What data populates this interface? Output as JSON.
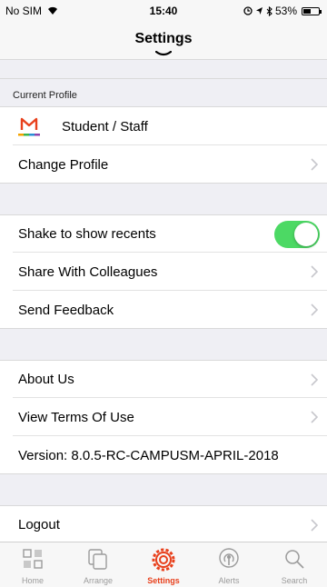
{
  "status_bar": {
    "carrier": "No SIM",
    "time": "15:40",
    "battery_percent": "53%",
    "battery_level": 0.53
  },
  "navbar": {
    "title": "Settings"
  },
  "current_profile": {
    "header": "Current Profile",
    "profile_name": "Student / Staff",
    "change_profile_label": "Change Profile"
  },
  "preferences": {
    "shake_label": "Shake to show recents",
    "shake_enabled": true,
    "share_label": "Share With Colleagues",
    "feedback_label": "Send Feedback"
  },
  "info": {
    "about_label": "About Us",
    "terms_label": "View Terms Of Use",
    "version_label": "Version: 8.0.5-RC-CAMPUSM-APRIL-2018"
  },
  "account": {
    "logout_label": "Logout"
  },
  "tabbar": {
    "tabs": [
      {
        "label": "Home",
        "icon": "home-grid-icon"
      },
      {
        "label": "Arrange",
        "icon": "arrange-icon"
      },
      {
        "label": "Settings",
        "icon": "settings-gear-icon",
        "active": true
      },
      {
        "label": "Alerts",
        "icon": "alerts-broadcast-icon"
      },
      {
        "label": "Search",
        "icon": "search-icon"
      }
    ]
  },
  "colors": {
    "accent": "#e8401c",
    "toggle_on": "#4cd964",
    "background": "#efeff4"
  }
}
